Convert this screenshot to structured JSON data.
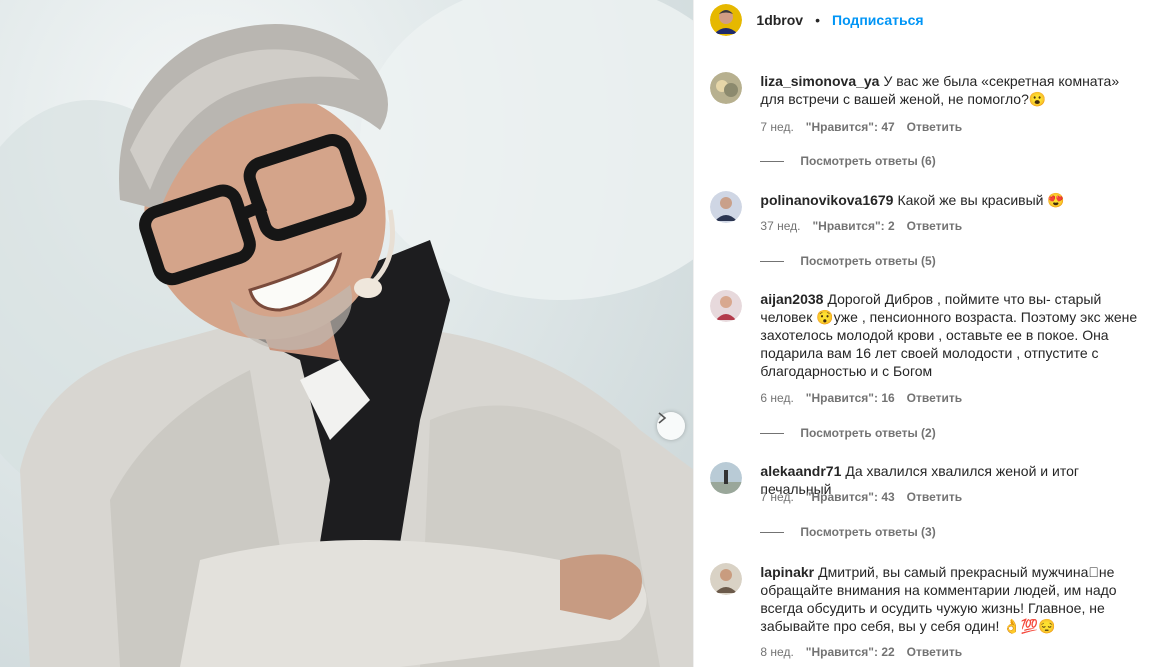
{
  "post": {
    "author": "1dbrov",
    "separator": "•",
    "follow_label": "Подписаться"
  },
  "comments": [
    {
      "user": "liza_simonova_ya",
      "text": "У вас же была «секретная комната» для встречи с вашей женой, не помогло?😮",
      "age": "7 нед.",
      "likes": "\"Нравится\": 47",
      "reply": "Ответить",
      "view_replies": "Посмотреть ответы (6)"
    },
    {
      "user": "polinanovikova1679",
      "text": "Какой же вы красивый 😍",
      "age": "37 нед.",
      "likes": "\"Нравится\": 2",
      "reply": "Ответить",
      "view_replies": "Посмотреть ответы (5)"
    },
    {
      "user": "aijan2038",
      "text": "Дорогой Дибров , поймите что вы- старый человек 😯уже , пенсионного возраста. Поэтому экс жене захотелось молодой крови , оставьте ее в покое. Она подарила вам 16 лет своей молодости , отпустите с благодарностью и с Богом",
      "age": "6 нед.",
      "likes": "\"Нравится\": 16",
      "reply": "Ответить",
      "view_replies": "Посмотреть ответы (2)"
    },
    {
      "user": "alekaandr71",
      "text": "Да хвалился хвалился женой и итог печальный",
      "age": "7 нед.",
      "likes": "\"Нравится\": 43",
      "reply": "Ответить",
      "view_replies": "Посмотреть ответы (3)"
    },
    {
      "user": "lapinakr",
      "text": "Дмитрий, вы самый прекрасный мужчина􏿽не обращайте внимания на комментарии людей, им надо всегда обсудить и осудить чужую жизнь! Главное, не забывайте про себя, вы у себя один! 👌💯😔",
      "age": "8 нед.",
      "likes": "\"Нравится\": 22",
      "reply": "Ответить"
    }
  ],
  "icons": {
    "next": "chevron-right-icon"
  }
}
